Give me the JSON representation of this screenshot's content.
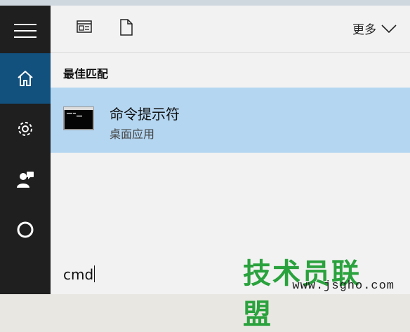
{
  "toolbar": {
    "more_label": "更多"
  },
  "best_match": {
    "title": "最佳匹配",
    "result": {
      "name": "命令提示符",
      "type": "桌面应用"
    }
  },
  "search": {
    "query": "cmd"
  },
  "watermark": {
    "main": "技术员联盟",
    "site": "www.jsgho.com"
  },
  "colors": {
    "rail_bg": "#1f1f1f",
    "rail_active": "#12507d",
    "panel_bg": "#f2f2f2",
    "result_highlight": "#b4d6f1",
    "watermark_green": "#2aa23d"
  },
  "icons": {
    "rail": [
      "hamburger-icon",
      "home-icon",
      "gear-icon",
      "feedback-icon",
      "cortana-circle-icon"
    ],
    "toolbar": [
      "apps-icon",
      "document-icon",
      "chevron-down-icon"
    ]
  }
}
